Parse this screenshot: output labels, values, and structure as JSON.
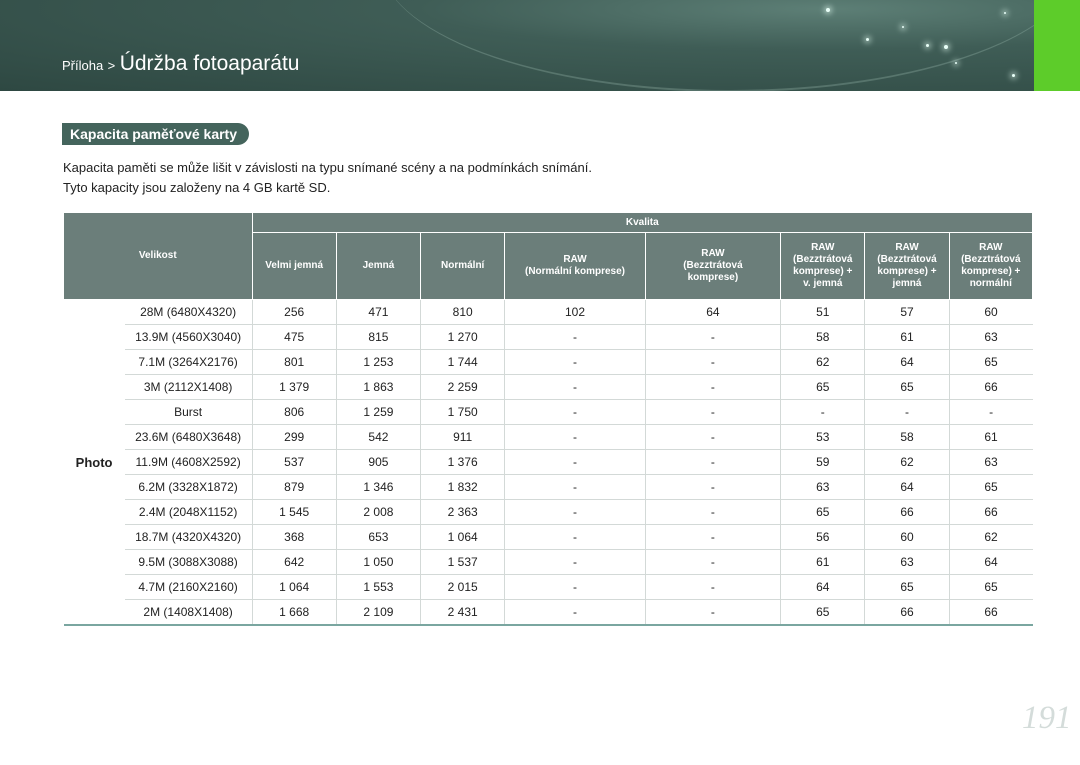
{
  "header": {
    "breadcrumb_parent": "Příloha",
    "breadcrumb_separator": ">",
    "title": "Údržba fotoaparátu",
    "accent_color": "#5dcc2a",
    "banner_color": "#3f5d56"
  },
  "section": {
    "title": "Kapacita paměťové karty",
    "intro_line1": "Kapacita paměti se může lišit v závislosti na typu snímané scény a na podmínkách snímání.",
    "intro_line2": "Tyto kapacity jsou založeny na 4 GB kartě SD."
  },
  "table": {
    "size_header": "Velikost",
    "quality_header": "Kvalita",
    "quality_columns": [
      [
        "Velmi jemná"
      ],
      [
        "Jemná"
      ],
      [
        "Normální"
      ],
      [
        "RAW",
        "(Normální komprese)"
      ],
      [
        "RAW",
        "(Bezztrátová",
        "komprese)"
      ],
      [
        "RAW",
        "(Bezztrátová",
        "komprese) +",
        "v. jemná"
      ],
      [
        "RAW",
        "(Bezztrátová",
        "komprese) +",
        "jemná"
      ],
      [
        "RAW",
        "(Bezztrátová",
        "komprese) +",
        "normální"
      ]
    ],
    "category": "Photo",
    "rows": [
      {
        "size": "28M (6480X4320)",
        "values": [
          "256",
          "471",
          "810",
          "102",
          "64",
          "51",
          "57",
          "60"
        ]
      },
      {
        "size": "13.9M (4560X3040)",
        "values": [
          "475",
          "815",
          "1 270",
          "-",
          "-",
          "58",
          "61",
          "63"
        ]
      },
      {
        "size": "7.1M (3264X2176)",
        "values": [
          "801",
          "1 253",
          "1 744",
          "-",
          "-",
          "62",
          "64",
          "65"
        ]
      },
      {
        "size": "3M (2112X1408)",
        "values": [
          "1 379",
          "1 863",
          "2 259",
          "-",
          "-",
          "65",
          "65",
          "66"
        ]
      },
      {
        "size": "Burst",
        "values": [
          "806",
          "1 259",
          "1 750",
          "-",
          "-",
          "-",
          "-",
          "-"
        ]
      },
      {
        "size": "23.6M (6480X3648)",
        "values": [
          "299",
          "542",
          "911",
          "-",
          "-",
          "53",
          "58",
          "61"
        ]
      },
      {
        "size": "11.9M (4608X2592)",
        "values": [
          "537",
          "905",
          "1 376",
          "-",
          "-",
          "59",
          "62",
          "63"
        ]
      },
      {
        "size": "6.2M (3328X1872)",
        "values": [
          "879",
          "1 346",
          "1 832",
          "-",
          "-",
          "63",
          "64",
          "65"
        ]
      },
      {
        "size": "2.4M (2048X1152)",
        "values": [
          "1 545",
          "2 008",
          "2 363",
          "-",
          "-",
          "65",
          "66",
          "66"
        ]
      },
      {
        "size": "18.7M (4320X4320)",
        "values": [
          "368",
          "653",
          "1 064",
          "-",
          "-",
          "56",
          "60",
          "62"
        ]
      },
      {
        "size": "9.5M (3088X3088)",
        "values": [
          "642",
          "1 050",
          "1 537",
          "-",
          "-",
          "61",
          "63",
          "64"
        ]
      },
      {
        "size": "4.7M (2160X2160)",
        "values": [
          "1 064",
          "1 553",
          "2 015",
          "-",
          "-",
          "64",
          "65",
          "65"
        ]
      },
      {
        "size": "2M (1408X1408)",
        "values": [
          "1 668",
          "2 109",
          "2 431",
          "-",
          "-",
          "65",
          "66",
          "66"
        ]
      }
    ]
  },
  "page_number": "191"
}
